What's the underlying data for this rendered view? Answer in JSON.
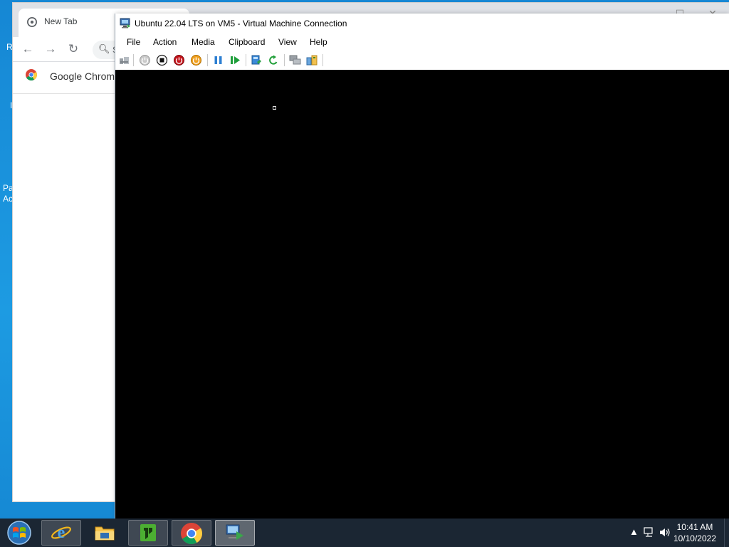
{
  "desktop": {
    "fragments": [
      "R",
      "I",
      "Pa",
      "Ac"
    ]
  },
  "chrome": {
    "tab_title": "New Tab",
    "omnibox_text": "S",
    "bookmark_label": "Google Chrome",
    "win_controls": [
      "–",
      "☐",
      "✕"
    ]
  },
  "vm": {
    "title": "Ubuntu 22.04 LTS on VM5 - Virtual Machine Connection",
    "menu": [
      "File",
      "Action",
      "Media",
      "Clipboard",
      "View",
      "Help"
    ],
    "toolbar_icons": [
      "ctrl-alt-del-icon",
      "start-icon",
      "turn-off-icon",
      "shut-down-icon",
      "save-icon",
      "pause-icon",
      "resume-icon",
      "checkpoint-icon",
      "revert-icon",
      "enhanced-session-icon",
      "share-icon"
    ]
  },
  "taskbar": {
    "apps": [
      "internet-explorer-icon",
      "file-explorer-icon",
      "terminal-app-icon",
      "google-chrome-icon",
      "hyper-v-connection-icon"
    ],
    "clock_time": "10:41 AM",
    "clock_date": "10/10/2022"
  }
}
